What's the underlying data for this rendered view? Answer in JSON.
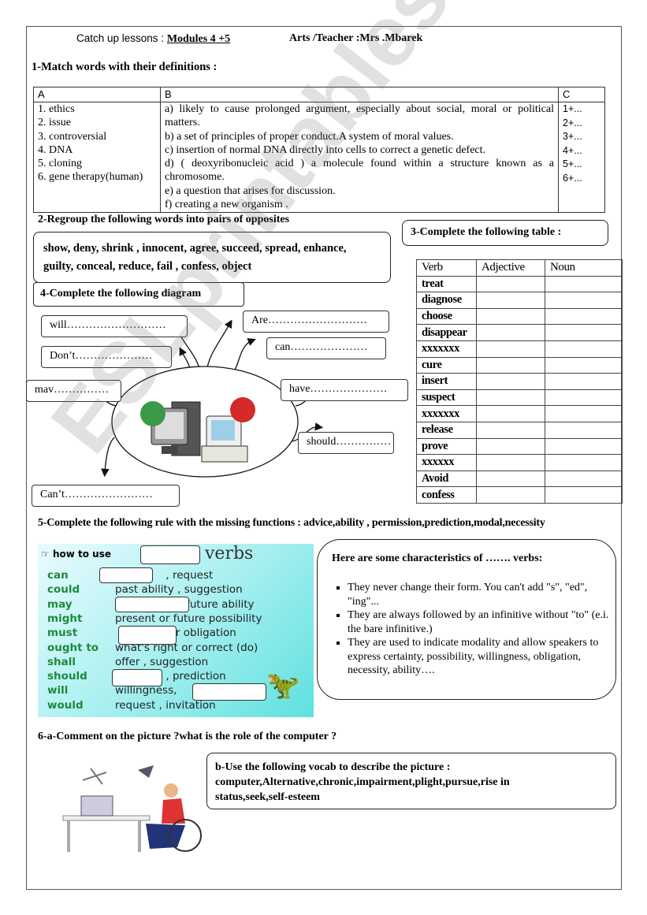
{
  "header": {
    "lessons_label": "Catch up lessons : ",
    "modules": "Modules 4 +5",
    "teacher": "Arts /Teacher :Mrs .Mbarek"
  },
  "s1": {
    "title": "1-Match words with their definitions :",
    "col_a": "A",
    "col_b": "B",
    "col_c": "C",
    "words": [
      "1. ethics",
      "2. issue",
      "3. controversial",
      " 4. DNA",
      "5. cloning",
      "6. gene therapy(human)"
    ],
    "definitions": [
      "a) likely to cause prolonged argument, especially about social, moral or political matters.",
      "b) a set of principles of proper conduct.A system of moral values.",
      "c) insertion of normal DNA directly into cells to correct a genetic defect.",
      "d) ( deoxyribonucleic acid ) a molecule found within a structure known as a chromosome.",
      "e) a question that arises for discussion.",
      "f) creating a new organism ."
    ],
    "answers": [
      "1+...",
      "2+...",
      "3+...",
      "4+...",
      "5+...",
      "6+..."
    ]
  },
  "s2": {
    "title": "2-Regroup the following words into pairs of opposites",
    "line1": "show, deny, shrink , innocent, agree, succeed, spread, enhance,",
    "line2": "guilty, conceal, reduce, fail , confess, object"
  },
  "s3": {
    "title": "3-Complete the following table :",
    "headers": [
      "Verb",
      "Adjective",
      "Noun"
    ],
    "verbs": [
      "treat",
      "diagnose",
      "choose",
      "disappear",
      "xxxxxxx",
      "cure",
      "insert",
      "suspect",
      "xxxxxxx",
      "release",
      "prove",
      "xxxxxx",
      "Avoid",
      "confess"
    ]
  },
  "s4": {
    "title": "4-Complete the following diagram",
    "boxes": {
      "will": "will………………………",
      "are": "Are………………………",
      "can": "can…………………",
      "dont": "Don’t…………………",
      "may": "mav……………",
      "have": "have…………………",
      "should": "should……………",
      "cant": "Can’t……………………"
    }
  },
  "s5": {
    "title_prefix": "5-Complete the following rule with the missing functions : ",
    "functions": "advice,ability , permission,prediction,modal,necessity",
    "image": {
      "how_to_use": "how to use",
      "verbs": "verbs",
      "rows": [
        {
          "verb": "can",
          "use": "               , request"
        },
        {
          "verb": "could",
          "use": "past ability , suggestion"
        },
        {
          "verb": "may",
          "use": "                   , future ability"
        },
        {
          "verb": "might",
          "use": "present or future possibility"
        },
        {
          "verb": "must",
          "use": "                or obligation"
        },
        {
          "verb": "ought to",
          "use": "what's right or correct (do)"
        },
        {
          "verb": "shall",
          "use": "offer , suggestion"
        },
        {
          "verb": "should",
          "use": "               , prediction"
        },
        {
          "verb": "will",
          "use": "willingness,"
        },
        {
          "verb": "would",
          "use": "request , invitation"
        }
      ]
    },
    "box_title": "Here are some characteristics of ……. verbs:",
    "bullets": [
      "They never change their form. You can't add \"s\", \"ed\", \"ing\"...",
      "They are always followed by an infinitive without \"to\" (e.i. the bare infinitive.)",
      "They are used to indicate modality and allow speakers to express certainty, possibility, willingness, obligation, necessity, ability…."
    ]
  },
  "s6": {
    "title": "6-a-Comment on the picture ?what is the role of the computer ?",
    "b_title": "b-Use the following vocab to describe the picture :",
    "vocab": "computer,Alternative,chronic,impairment,plight,pursue,rise in status,seek,self-esteem"
  },
  "watermark": "ESLprintables.com"
}
